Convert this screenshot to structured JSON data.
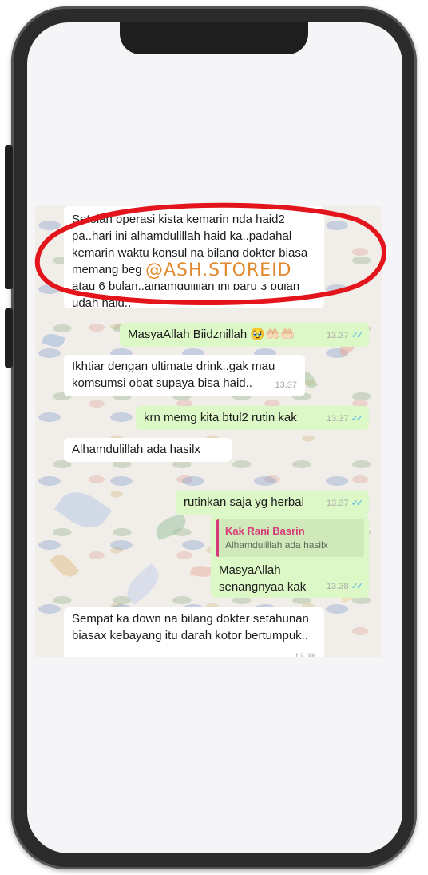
{
  "chat": {
    "messages": [
      {
        "text": "Setelah operasi kista kemarin nda haid2 pa..hari ini alhamdulillah haid ka..padahal kemarin waktu konsul na bilang dokter biasa memang begitu lama biasa ampe setahun atau 6 bulan..alhamdulillah ini baru 3 bulan udah haid..",
        "time": ""
      },
      {
        "text": "MasyaAllah Biidznillah 🥹🤲🏻🤲🏻",
        "time": "13.37"
      },
      {
        "text": "Ikhtiar dengan ultimate drink..gak mau komsumsi obat supaya bisa haid..",
        "time": "13.37"
      },
      {
        "text": "krn memg kita btul2 rutin kak",
        "time": "13.37"
      },
      {
        "text": "Alhamdulillah ada hasilx",
        "time": ""
      },
      {
        "text": "rutinkan saja yg herbal",
        "time": "13.37"
      },
      {
        "quote_name": "Kak Rani Basrin",
        "quote_text": "Alhamdulillah ada hasilx",
        "text": "MasyaAllah senangnyaa kak",
        "time": "13.38"
      },
      {
        "text": "Sempat ka down na bilang dokter setahunan biasax kebayang itu darah kotor bertumpuk..",
        "time": "13.38"
      }
    ]
  },
  "watermark": "@ASH.STOREID",
  "colors": {
    "incoming_bubble": "#ffffff",
    "outgoing_bubble": "#dcf8c6",
    "highlight_circle": "#e3141b",
    "quote_accent": "#d63b78",
    "read_ticks": "#4fb6ec"
  }
}
